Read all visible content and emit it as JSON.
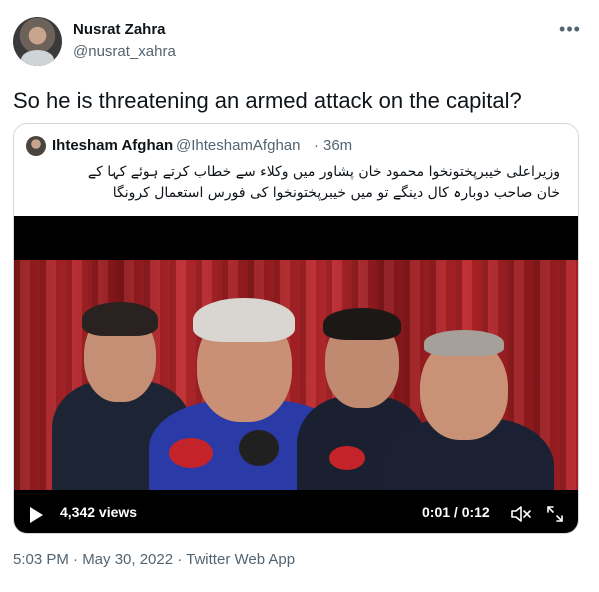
{
  "author": {
    "display_name": "Nusrat Zahra",
    "handle": "@nusrat_xahra"
  },
  "more_icon": "more-horizontal-icon",
  "tweet": {
    "text": "So he is threatening an armed attack on the capital?"
  },
  "quoted_tweet": {
    "display_name": "Ihtesham Afghan",
    "handle": "@IhteshamAfghan",
    "separator": "·",
    "time_ago": "36m",
    "text_line1": "وزیراعلی خیبرپختونخوا محمود خان پشاور میں  وکلاء سے خطاب کرتے ہوئے کہا کے",
    "text_line2": "خان صاحب دوبارہ کال دینگے تو میں  خیبرپختونخوا کی فورس استعمال کرونگا",
    "video": {
      "views": "4,342 views",
      "time_readout": "0:01 / 0:12",
      "progress": 0.08,
      "icons": [
        "play-icon",
        "mute-icon",
        "fullscreen-icon"
      ]
    }
  },
  "meta": {
    "timestamp_line": "5:03 PM · May 30, 2022 · Twitter Web App"
  },
  "colors": {
    "text": "#0f1419",
    "secondary": "#536471",
    "border": "#cfd9de",
    "curtain": "#b8262a"
  }
}
